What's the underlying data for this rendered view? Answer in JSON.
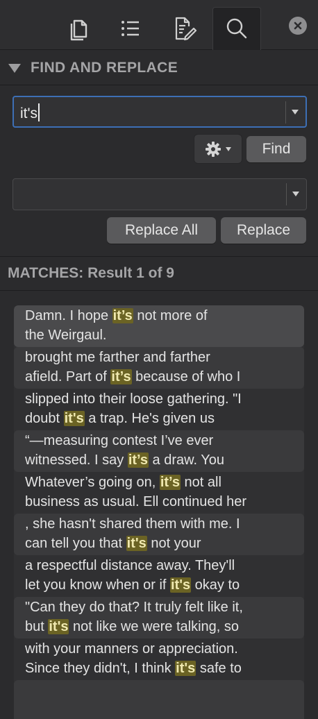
{
  "toolbar": {
    "tabs": [
      {
        "icon": "documents-icon"
      },
      {
        "icon": "list-icon"
      },
      {
        "icon": "edit-notes-icon"
      },
      {
        "icon": "search-icon",
        "active": true
      }
    ],
    "close_icon": "close-icon"
  },
  "find_replace": {
    "section_title": "FIND AND REPLACE",
    "find_value": "it's",
    "replace_value": "",
    "find_button": "Find",
    "replace_all_button": "Replace All",
    "replace_button": "Replace",
    "options_icon": "gear-icon"
  },
  "matches": {
    "label": "MATCHES: Result 1 of 9",
    "results": [
      {
        "pre1": "Damn. I hope ",
        "match1": "it’s",
        "post1": " not more of",
        "line2_pre": "the Weirgaul.",
        "line2_match": "",
        "line2_post": ""
      },
      {
        "pre1": "brought me farther and farther",
        "match1": "",
        "post1": "",
        "line2_pre": "afield. Part of ",
        "line2_match": "it’s",
        "line2_post": " because of who I"
      },
      {
        "pre1": "slipped into their loose gathering. \"I",
        "match1": "",
        "post1": "",
        "line2_pre": "doubt ",
        "line2_match": "it's",
        "line2_post": " a trap. He's given us"
      },
      {
        "pre1": "“—measuring contest I’ve ever",
        "match1": "",
        "post1": "",
        "line2_pre": "witnessed. I say ",
        "line2_match": "it’s",
        "line2_post": " a draw. You"
      },
      {
        "pre1": "Whatever’s going on, ",
        "match1": "it’s",
        "post1": " not all",
        "line2_pre": "business as usual. Ell continued her",
        "line2_match": "",
        "line2_post": ""
      },
      {
        "pre1": ", she hasn't shared them with me. I",
        "match1": "",
        "post1": "",
        "line2_pre": "can tell you that ",
        "line2_match": "it's",
        "line2_post": " not your"
      },
      {
        "pre1": "a respectful distance away. They'll",
        "match1": "",
        "post1": "",
        "line2_pre": "let you know when or if ",
        "line2_match": "it's",
        "line2_post": " okay to"
      },
      {
        "pre1": "\"Can they do that? It truly felt like it,",
        "match1": "",
        "post1": "",
        "line2_pre": "but ",
        "line2_match": "it's",
        "line2_post": " not like we were talking, so"
      },
      {
        "pre1": "with your manners or appreciation.",
        "match1": "",
        "post1": "",
        "line2_pre": "Since they didn't, I think ",
        "line2_match": "it's",
        "line2_post": " safe to"
      }
    ]
  }
}
